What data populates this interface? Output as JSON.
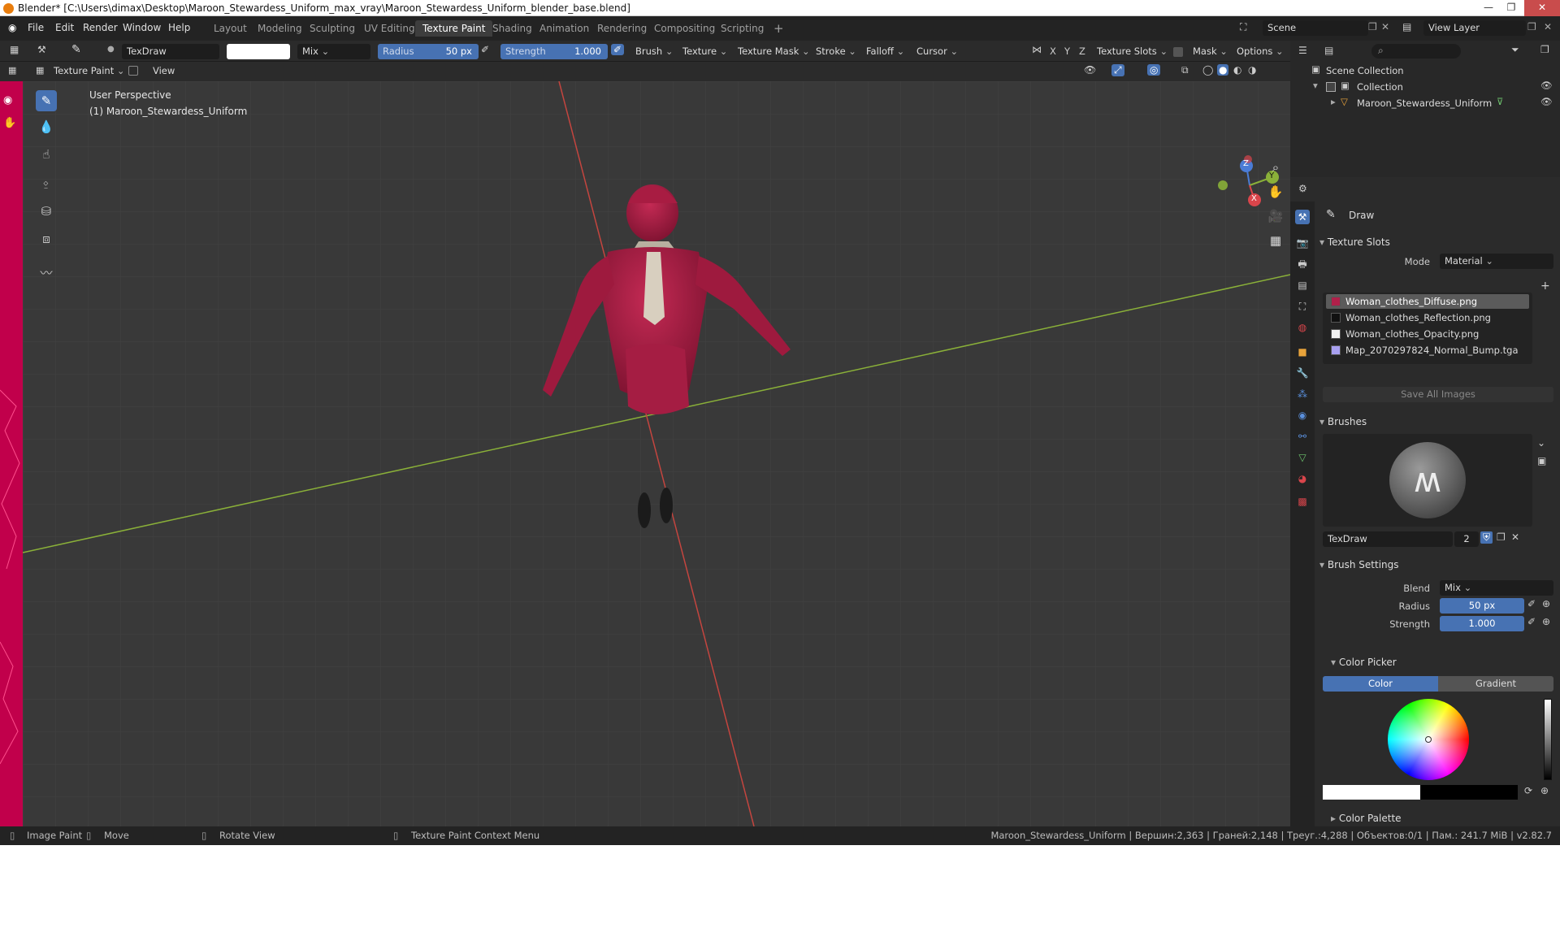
{
  "window": {
    "title": "Blender* [C:\\Users\\dimax\\Desktop\\Maroon_Stewardess_Uniform_max_vray\\Maroon_Stewardess_Uniform_blender_base.blend]"
  },
  "menu": [
    "File",
    "Edit",
    "Render",
    "Window",
    "Help"
  ],
  "workspaces": [
    "Layout",
    "Modeling",
    "Sculpting",
    "UV Editing",
    "Texture Paint",
    "Shading",
    "Animation",
    "Rendering",
    "Compositing",
    "Scripting"
  ],
  "active_workspace": "Texture Paint",
  "scene": {
    "name": "Scene",
    "view_layer": "View Layer"
  },
  "toolheader": {
    "brush_name": "TexDraw",
    "blend": "Mix",
    "radius_label": "Radius",
    "radius_value": "50 px",
    "strength_label": "Strength",
    "strength_value": "1.000",
    "menus": [
      "Brush",
      "Texture",
      "Texture Mask",
      "Stroke",
      "Falloff",
      "Cursor"
    ],
    "axes": [
      "X",
      "Y",
      "Z"
    ],
    "texture_slots": "Texture Slots",
    "mask": "Mask",
    "options": "Options"
  },
  "viewheader": {
    "mode": "Texture Paint",
    "view": "View"
  },
  "viewport": {
    "perspective": "User Perspective",
    "object": "(1) Maroon_Stewardess_Uniform",
    "gizmo": {
      "z": "Z",
      "y": "Y",
      "x": "X"
    }
  },
  "outliner": {
    "scene_collection": "Scene Collection",
    "collection": "Collection",
    "object": "Maroon_Stewardess_Uniform"
  },
  "properties": {
    "tool_name": "Draw",
    "texture_slots": {
      "title": "Texture Slots",
      "mode_label": "Mode",
      "mode_value": "Material",
      "slots": [
        {
          "name": "Woman_clothes_Diffuse.png",
          "color": "#b0204a"
        },
        {
          "name": "Woman_clothes_Reflection.png",
          "color": "#111111"
        },
        {
          "name": "Woman_clothes_Opacity.png",
          "color": "#f2f2f2"
        },
        {
          "name": "Map_2070297824_Normal_Bump.tga",
          "color": "#a8a0f0"
        }
      ],
      "save_all": "Save All Images"
    },
    "brushes": {
      "title": "Brushes",
      "brush_name": "TexDraw",
      "users": "2"
    },
    "brush_settings": {
      "title": "Brush Settings",
      "blend_label": "Blend",
      "blend_value": "Mix",
      "radius_label": "Radius",
      "radius_value": "50 px",
      "strength_label": "Strength",
      "strength_value": "1.000"
    },
    "color_picker": {
      "title": "Color Picker",
      "tab_color": "Color",
      "tab_gradient": "Gradient"
    },
    "color_palette": "Color Palette"
  },
  "statusbar": {
    "image_paint": "Image Paint",
    "move": "Move",
    "rotate": "Rotate View",
    "context": "Texture Paint Context Menu",
    "stats": "Maroon_Stewardess_Uniform | Вершин:2,363 | Граней:2,148 | Треуг.:4,288 | Объектов:0/1 | Пам.: 241.7 MiB | v2.82.7"
  },
  "colors": {
    "accent": "#4772b3",
    "uniform": "#9b1b3d",
    "strip": "#c1004b"
  }
}
